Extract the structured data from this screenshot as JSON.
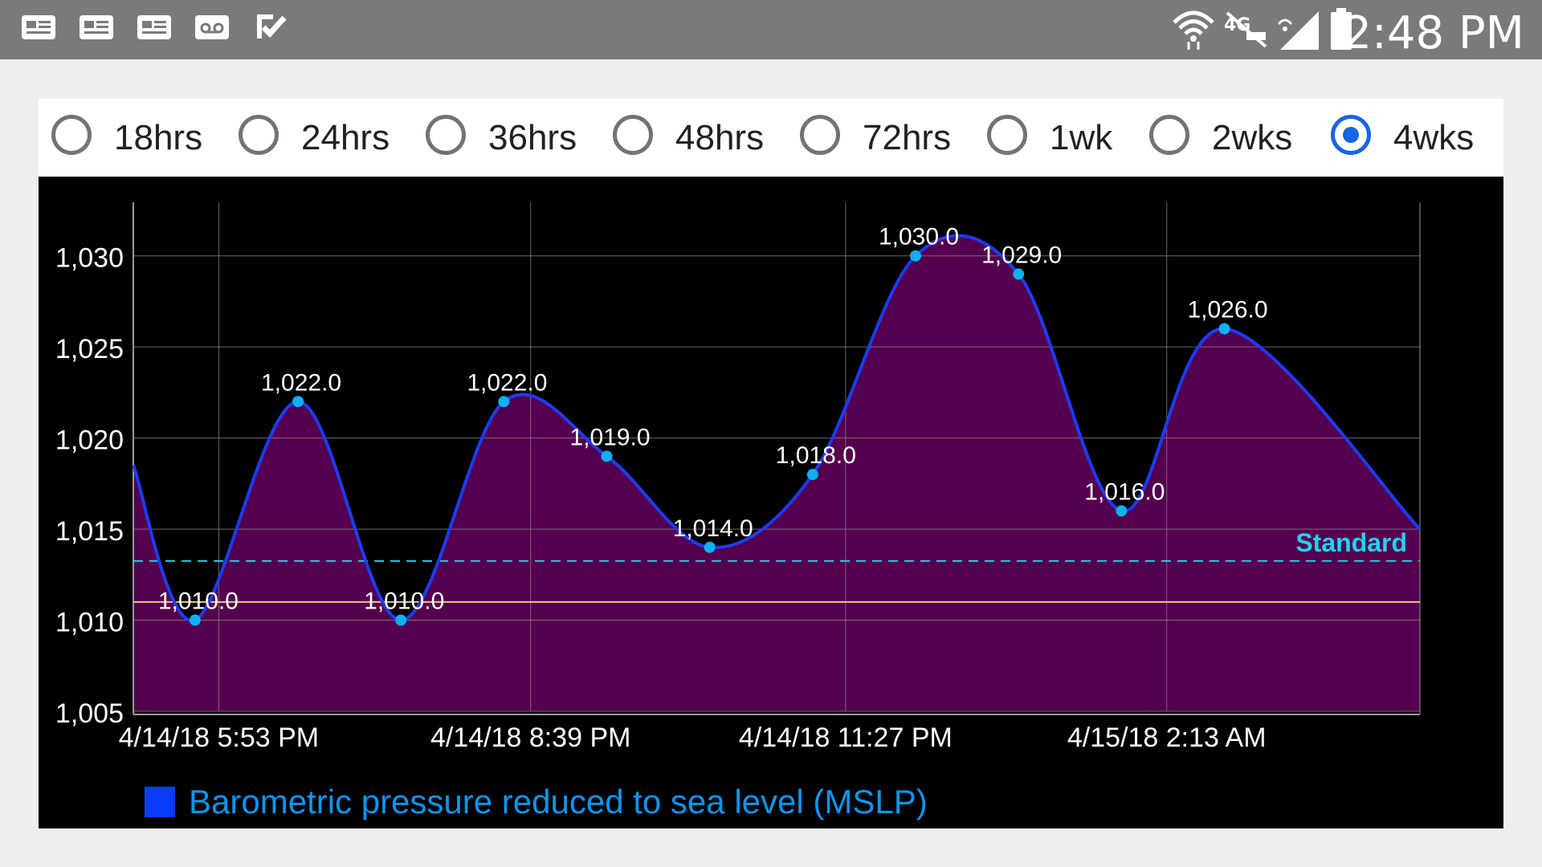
{
  "status_bar": {
    "time": "2:48 PM",
    "left_icons": [
      "news-icon",
      "news-icon",
      "news-icon",
      "voicemail-icon",
      "task-check-icon"
    ],
    "right_icons": [
      "wifi-icon",
      "4g-lte-icon",
      "signal-icon",
      "battery-icon"
    ]
  },
  "range_selector": {
    "selected": "4wks",
    "options": [
      {
        "label": "18hrs"
      },
      {
        "label": "24hrs"
      },
      {
        "label": "36hrs"
      },
      {
        "label": "48hrs"
      },
      {
        "label": "72hrs"
      },
      {
        "label": "1wk"
      },
      {
        "label": "2wks"
      },
      {
        "label": "4wks"
      }
    ]
  },
  "colors": {
    "accent": "#1565e6",
    "line": "#1d3cf2",
    "fill": "#55004f",
    "point": "#0fb0f2",
    "standard_line": "#22d3ee",
    "reference_line": "#e8c98a",
    "legend_text": "#0b96f0"
  },
  "chart_data": {
    "type": "area",
    "y_tick_labels": [
      "1,005",
      "1,010",
      "1,015",
      "1,020",
      "1,025",
      "1,030"
    ],
    "ylim": [
      1005,
      1032.5
    ],
    "x_tick_labels": [
      "4/14/18 5:53 PM",
      "4/14/18 8:39 PM",
      "4/14/18 11:27 PM",
      "4/15/18 2:13 AM"
    ],
    "x_tick_index": [
      0.23,
      3.26,
      6.32,
      9.44
    ],
    "x_range": [
      -0.6,
      11.9
    ],
    "series": [
      {
        "name": "Barometric pressure reduced to sea level (MSLP)",
        "x": [
          0,
          1,
          2,
          3,
          4,
          5,
          6,
          7,
          8,
          9,
          10
        ],
        "values": [
          1010.0,
          1022.0,
          1010.0,
          1022.0,
          1019.0,
          1014.0,
          1018.0,
          1030.0,
          1029.0,
          1016.0,
          1026.0
        ],
        "data_labels": [
          "1,010.0",
          "1,022.0",
          "1,010.0",
          "1,022.0",
          "1,019.0",
          "1,014.0",
          "1,018.0",
          "1,030.0",
          "1,029.0",
          "1,016.0",
          "1,026.0"
        ],
        "edge_start_value": 1018.5,
        "edge_end_value": 1015.0
      }
    ],
    "reference_lines": [
      {
        "label": "Standard",
        "value": 1013.25,
        "style": "dashed"
      },
      {
        "label": "",
        "value": 1011.0,
        "style": "solid"
      }
    ],
    "grid": true,
    "legend": "bottom-left"
  }
}
